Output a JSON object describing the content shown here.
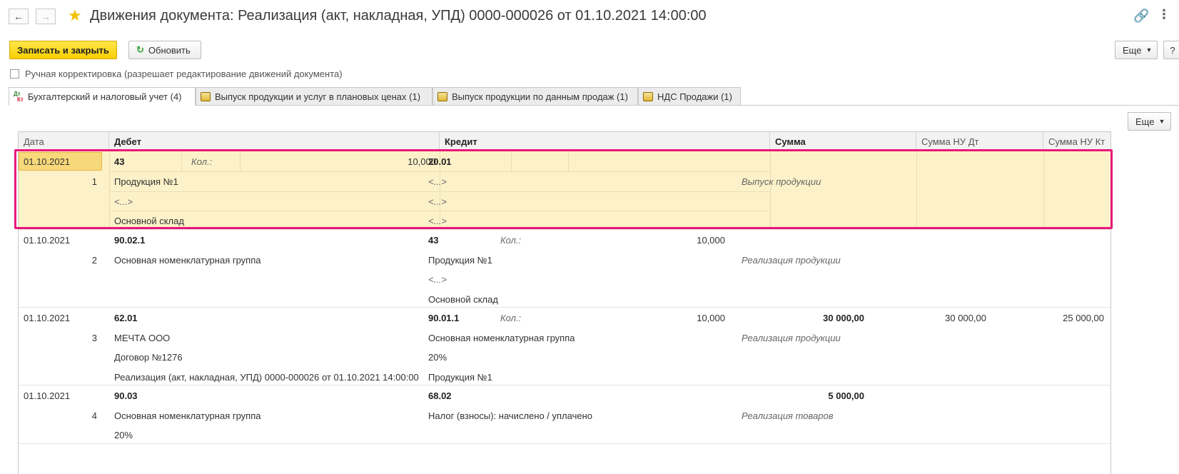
{
  "title": "Движения документа: Реализация (акт, накладная, УПД) 0000-000026 от 01.10.2021 14:00:00",
  "toolbar": {
    "save_close": "Записать и закрыть",
    "refresh": "Обновить",
    "more": "Еще",
    "help": "?"
  },
  "manual_correction": "Ручная корректировка (разрешает редактирование движений документа)",
  "tabs": [
    {
      "label": "Бухгалтерский и налоговый учет (4)",
      "icon": "dt-kt-icon"
    },
    {
      "label": "Выпуск продукции и услуг в плановых ценах (1)",
      "icon": "register-icon"
    },
    {
      "label": "Выпуск продукции по данным продаж (1)",
      "icon": "register-icon"
    },
    {
      "label": "НДС Продажи (1)",
      "icon": "register-icon"
    }
  ],
  "table_more": "Еще",
  "icons": {
    "dtkt_dt": "Дт",
    "dtkt_kt": "Кт"
  },
  "columns": [
    "Дата",
    "Дебет",
    "Кредит",
    "Сумма",
    "Сумма НУ Дт",
    "Сумма НУ Кт"
  ],
  "rows": [
    {
      "date": "01.10.2021",
      "num": "1",
      "debit": {
        "account": "43",
        "qty_label": "Кол.:",
        "qty": "10,000",
        "lines": [
          "Продукция №1",
          "<...>",
          "Основной склад"
        ]
      },
      "credit": {
        "account": "20.01",
        "qty_label": "",
        "qty": "",
        "lines": [
          "<...>",
          "<...>",
          "<...>"
        ]
      },
      "sum": "",
      "content": "Выпуск продукции",
      "nu_dt": "",
      "nu_kt": ""
    },
    {
      "date": "01.10.2021",
      "num": "2",
      "debit": {
        "account": "90.02.1",
        "qty_label": "",
        "qty": "",
        "lines": [
          "Основная номенклатурная группа",
          "",
          ""
        ]
      },
      "credit": {
        "account": "43",
        "qty_label": "Кол.:",
        "qty": "10,000",
        "lines": [
          "Продукция №1",
          "<...>",
          "Основной склад"
        ]
      },
      "sum": "",
      "content": "Реализация продукции",
      "nu_dt": "",
      "nu_kt": ""
    },
    {
      "date": "01.10.2021",
      "num": "3",
      "debit": {
        "account": "62.01",
        "qty_label": "",
        "qty": "",
        "lines": [
          "МЕЧТА ООО",
          "Договор №1276",
          "Реализация (акт, накладная, УПД) 0000-000026 от 01.10.2021 14:00:00"
        ]
      },
      "credit": {
        "account": "90.01.1",
        "qty_label": "Кол.:",
        "qty": "10,000",
        "lines": [
          "Основная номенклатурная группа",
          "20%",
          "Продукция №1"
        ]
      },
      "sum": "30 000,00",
      "content": "Реализация продукции",
      "nu_dt": "30 000,00",
      "nu_kt": "25 000,00"
    },
    {
      "date": "01.10.2021",
      "num": "4",
      "debit": {
        "account": "90.03",
        "qty_label": "",
        "qty": "",
        "lines": [
          "Основная номенклатурная группа",
          "20%",
          ""
        ]
      },
      "credit": {
        "account": "68.02",
        "qty_label": "",
        "qty": "",
        "lines": [
          "Налог (взносы): начислено / уплачено",
          "",
          ""
        ]
      },
      "sum": "5 000,00",
      "content": "Реализация товаров",
      "nu_dt": "",
      "nu_kt": ""
    }
  ],
  "colors": {
    "accent_yellow": "#f8cf00",
    "selection": "#fcf1c8",
    "highlight_frame": "#e8177a"
  }
}
